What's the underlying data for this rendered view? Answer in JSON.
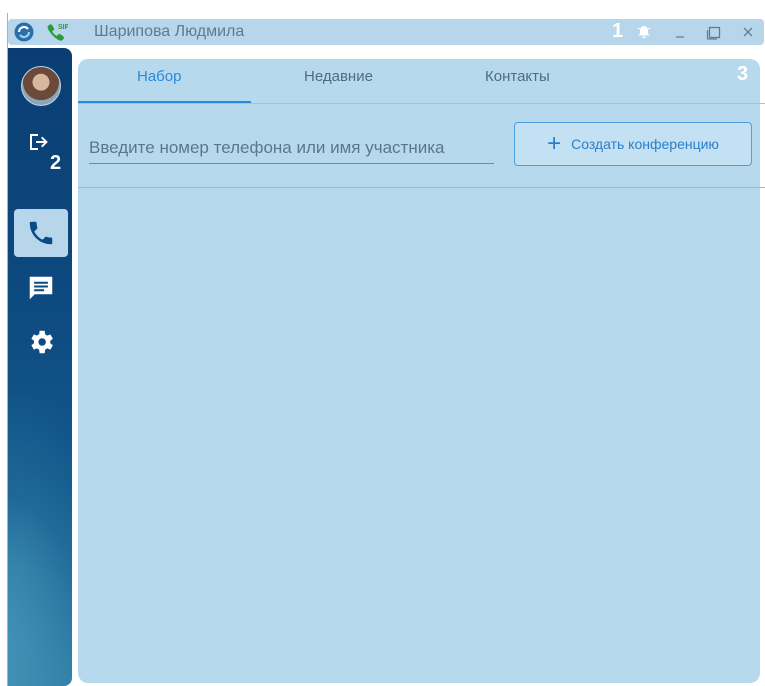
{
  "window": {
    "title": "Шарипова Людмила"
  },
  "titlebar": {
    "badge": "1",
    "icons": [
      "app-logo-icon",
      "sip-phone-icon",
      "bell-icon",
      "minimize-icon",
      "maximize-icon",
      "close-icon"
    ]
  },
  "sidebar": {
    "badge": "2",
    "items": [
      {
        "name": "avatar"
      },
      {
        "icon": "logout-icon"
      },
      {
        "icon": "phone-icon",
        "active": true
      },
      {
        "icon": "chat-icon"
      },
      {
        "icon": "settings-icon"
      }
    ]
  },
  "panel": {
    "badge": "3",
    "tabs": [
      {
        "label": "Набор",
        "active": true
      },
      {
        "label": "Недавние"
      },
      {
        "label": "Контакты"
      }
    ],
    "search": {
      "placeholder": "Введите номер телефона или имя участника"
    },
    "conference_button": {
      "label": "Создать конференцию"
    }
  },
  "colors": {
    "accent": "#2a8ad6",
    "panel_bg": "#b7d9ee",
    "sidebar_bg": "#0d4a80"
  }
}
